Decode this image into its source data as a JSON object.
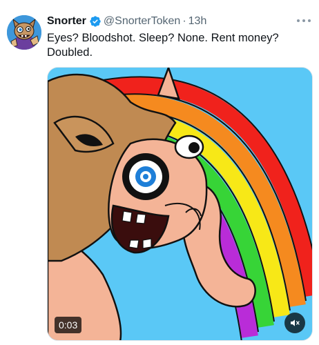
{
  "tweet": {
    "author": {
      "display_name": "Snorter",
      "handle": "@SnorterToken",
      "avatar_icon": "cartoon-creature-avatar",
      "verified_icon": "verified-badge-icon"
    },
    "separator": "·",
    "timestamp": "13h",
    "text": "Eyes? Bloodshot. Sleep? None. Rent money? Doubled.",
    "more_icon": "more-options-icon",
    "media": {
      "type": "video",
      "duration": "0:03",
      "mute_icon": "muted-speaker-icon",
      "description_icon": "cartoon-llama-rainbow"
    }
  },
  "colors": {
    "verified": "#1d9bf0",
    "muted_text": "#536471",
    "text": "#0f1419",
    "sky": "#5ac8f6"
  }
}
